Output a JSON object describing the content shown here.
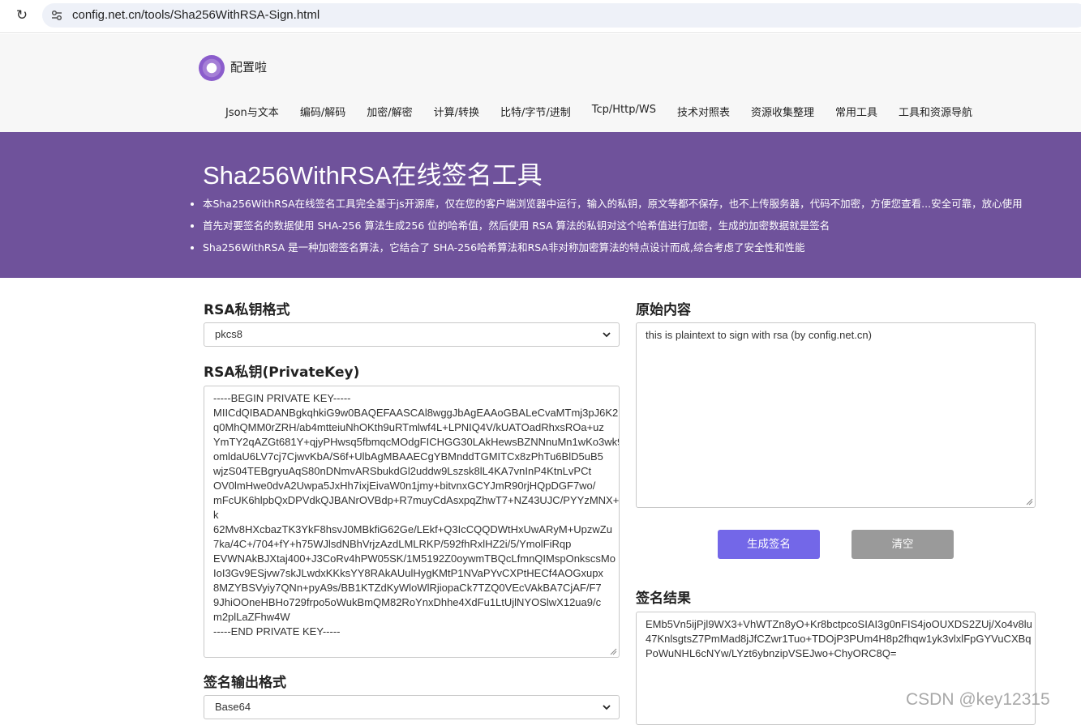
{
  "browser": {
    "url": "config.net.cn/tools/Sha256WithRSA-Sign.html"
  },
  "site": {
    "brand": "配置啦",
    "nav": [
      "Json与文本",
      "编码/解码",
      "加密/解密",
      "计算/转换",
      "比特/字节/进制",
      "Tcp/Http/WS",
      "技术对照表",
      "资源收集整理",
      "常用工具",
      "工具和资源导航"
    ]
  },
  "banner": {
    "title": "Sha256WithRSA在线签名工具",
    "points": [
      "本Sha256WithRSA在线签名工具完全基于js开源库，仅在您的客户端浏览器中运行，输入的私钥，原文等都不保存，也不上传服务器，代码不加密，方便您查看...安全可靠，放心使用",
      "首先对要签名的数据使用 SHA-256 算法生成256 位的哈希值，然后使用 RSA 算法的私钥对这个哈希值进行加密，生成的加密数据就是签名",
      "Sha256WithRSA 是一种加密签名算法，它结合了 SHA-256哈希算法和RSA非对称加密算法的特点设计而成,综合考虑了安全性和性能"
    ]
  },
  "form": {
    "format_label": "RSA私钥格式",
    "format_value": "pkcs8",
    "key_label": "RSA私钥(PrivateKey)",
    "private_key": "-----BEGIN PRIVATE KEY-----\nMIICdQIBADANBgkqhkiG9w0BAQEFAASCAl8wggJbAgEAAoGBALeCvaMTmj3pJ6K2\nq0MhQMM0rZRH/ab4mtteiuNhOKth9uRTmlwf4L+LPNIQ4V/kUATOadRhxsROa+uz\nYmTY2qAZGt681Y+qjyPHwsq5fbmqcMOdgFICHGG30LAkHewsBZNNnuMn1wKo3wk9\nomldaU6LV7cj7CjwvKbA/S6f+UlbAgMBAAECgYBMnddTGMITCx8zPhTu6BlD5uB5\nwjzS04TEBgryuAqS80nDNmvARSbukdGl2uddw9Lszsk8lL4KA7vnInP4KtnLvPCt\nOV0lmHwe0dvA2Uwpa5JxHh7ixjEivaW0n1jmy+bitvnxGCYJmR90rjHQpDGF7wo/\nmFcUK6hlpbQxDPVdkQJBANrOVBdp+R7muyCdAsxpqZhwT7+NZ43UJC/PYYzMNX+\nk\n62Mv8HXcbazTK3YkF8hsvJ0MBkfiG62Ge/LEkf+Q3IcCQQDWtHxUwARyM+UpzwZu\n7ka/4C+/704+fY+h75WJlsdNBhVrjzAzdLMLRKP/592fhRxlHZ2i/5/YmolFiRqp\nEVWNAkBJXtaj400+J3CoRv4hPW05SK/1M5192Z0oywmTBQcLfmnQIMspOnkscsMo\nIoI3Gv9ESjvw7skJLwdxKKksYY8RAkAUulHygKMtP1NVaPYvCXPtHECf4AOGxupx\n8MZYBSVyiy7QNn+pyA9s/BB1KTZdKyWloWlRjiopaCk7TZQ0VEcVAkBA7CjAF/F7\n9JhiOOneHBHo729frpo5oWukBmQM82RoYnxDhhe4XdFu1LtUjlNYOSlwX12ua9/c\nm2plLaZFhw4W\n-----END PRIVATE KEY-----",
    "output_label": "签名输出格式",
    "output_value": "Base64",
    "content_label": "原始内容",
    "content_value": "this is plaintext to sign with rsa (by config.net.cn)",
    "sign_button": "生成签名",
    "clear_button": "清空",
    "result_label": "签名结果",
    "result_value": "EMb5Vn5ijPjl9WX3+VhWTZn8yO+Kr8bctpcoSIAI3g0nFIS4joOUXDS2ZUj/Xo4v8lu\n47KnlsgtsZ7PmMad8jJfCZwr1Tuo+TDOjP3PUm4H8p2fhqw1yk3vlxlFpGYVuCXBq\nPoWuNHL6cNYw/LYzt6ybnzipVSEJwo+ChyORC8Q="
  },
  "watermark": "CSDN @key12315",
  "colors": {
    "banner": "#6f529b",
    "primary_button": "#7367e8",
    "secondary_button": "#9a9a9a"
  }
}
